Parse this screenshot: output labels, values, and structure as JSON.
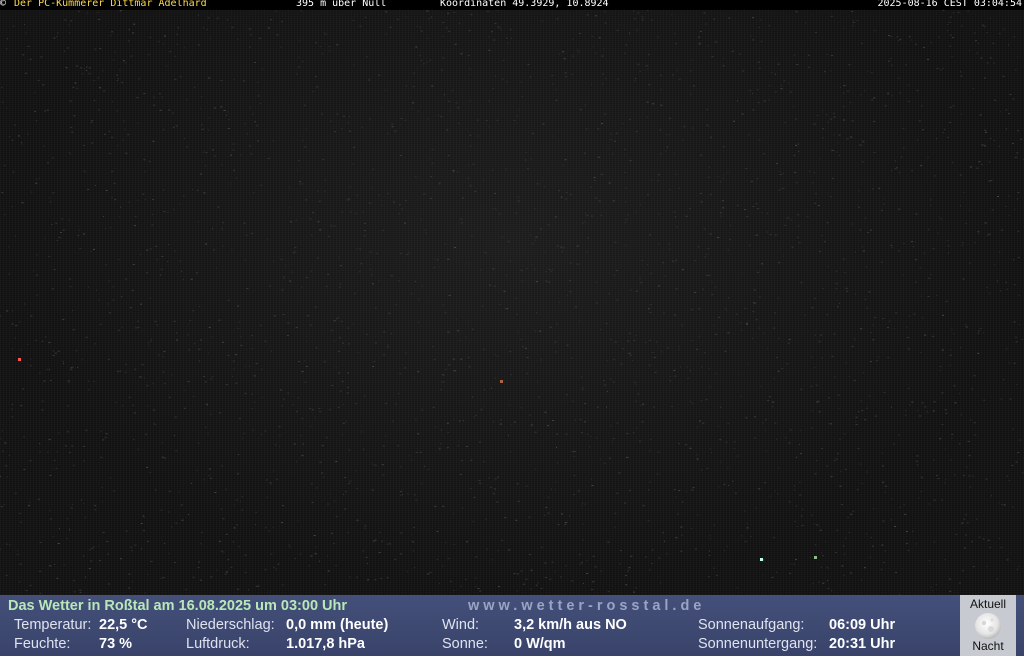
{
  "overlay": {
    "copyright": "©",
    "owner": "Der PC-Kümmerer Dittmar Adelhard",
    "altitude": "395 m über Null",
    "coordinates": "Koordinaten 49.3929, 10.8924",
    "timestamp": "2025-08-16 CEST 03:04:54"
  },
  "camera": {
    "scene": "night sky, dark and noisy",
    "icon": "webcam-image"
  },
  "weather": {
    "headline": "Das Wetter in Roßtal am 16.08.2025 um 03:00 Uhr",
    "website": "www.wetter-rosstal.de",
    "temperature_label": "Temperatur:",
    "temperature_value": "22,5 °C",
    "humidity_label": "Feuchte:",
    "humidity_value": "73 %",
    "precip_label": "Niederschlag:",
    "precip_value": "0,0 mm (heute)",
    "pressure_label": "Luftdruck:",
    "pressure_value": "1.017,8 hPa",
    "wind_label": "Wind:",
    "wind_value": "3,2 km/h aus NO",
    "sun_label": "Sonne:",
    "sun_value": "0 W/qm",
    "sunrise_label": "Sonnenaufgang:",
    "sunrise_value": "06:09 Uhr",
    "sunset_label": "Sonnenuntergang:",
    "sunset_value": "20:31 Uhr"
  },
  "moon": {
    "label_top": "Aktuell",
    "label_bottom": "Nacht",
    "icon": "full-moon-icon"
  },
  "colors": {
    "panel": "#3b456b",
    "headline": "#b8e8b8",
    "owner": "#ffd84a"
  }
}
